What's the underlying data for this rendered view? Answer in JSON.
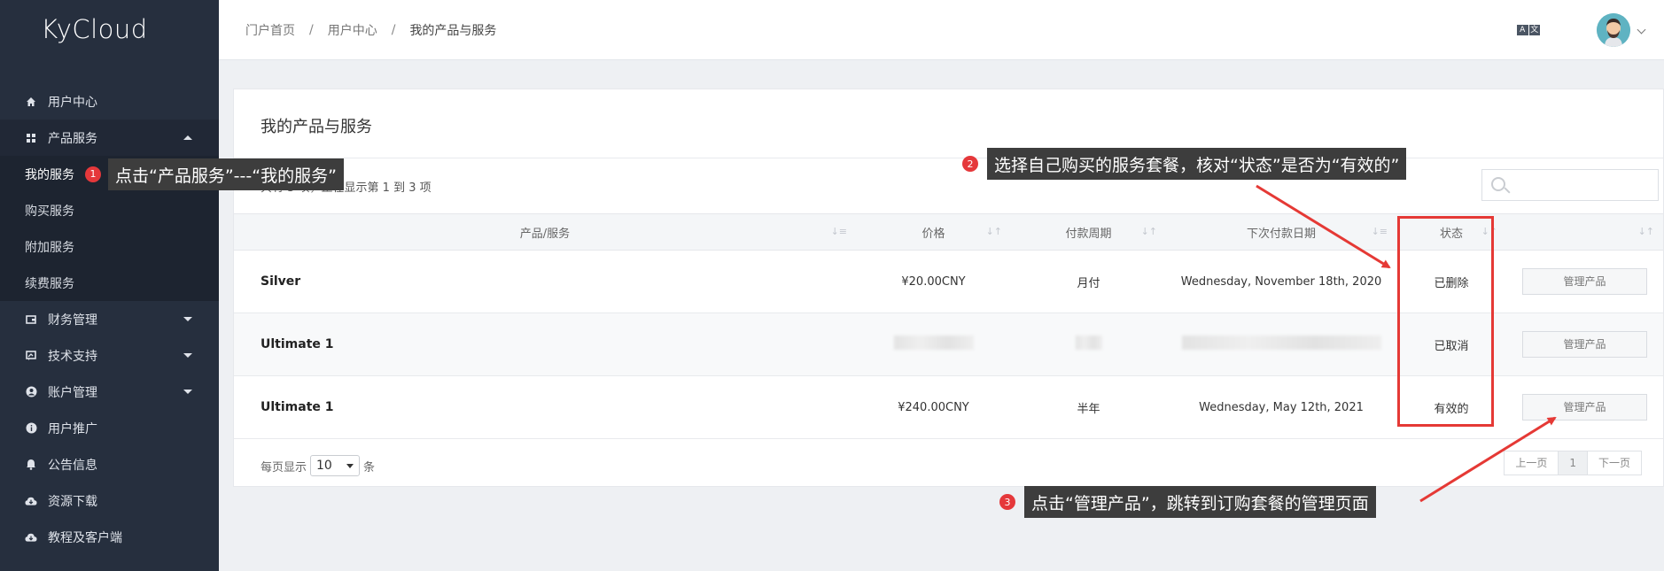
{
  "brand": "KyCloud",
  "sidebar": {
    "items": [
      {
        "label": "用户中心",
        "icon": "home-icon"
      },
      {
        "label": "产品服务",
        "icon": "grid-icon"
      },
      {
        "label": "财务管理",
        "icon": "wallet-icon"
      },
      {
        "label": "技术支持",
        "icon": "support-icon"
      },
      {
        "label": "账户管理",
        "icon": "user-icon"
      },
      {
        "label": "用户推广",
        "icon": "info-icon"
      },
      {
        "label": "公告信息",
        "icon": "bell-icon"
      },
      {
        "label": "资源下载",
        "icon": "cloud-download-icon"
      },
      {
        "label": "教程及客户端",
        "icon": "cloud-download-icon"
      }
    ],
    "sub_items": [
      "我的服务",
      "购买服务",
      "附加服务",
      "续费服务"
    ]
  },
  "breadcrumb": {
    "home": "门户首页",
    "user_center": "用户中心",
    "current": "我的产品与服务",
    "sep": "/"
  },
  "lang_icon": {
    "left": "A",
    "right": "文"
  },
  "panel": {
    "title": "我的产品与服务",
    "count": "共有 3 项，正在显示第 1 到 3 项"
  },
  "table": {
    "headers": [
      "产品/服务",
      "价格",
      "付款周期",
      "下次付款日期",
      "状态"
    ],
    "rows": [
      {
        "name": "Silver",
        "price": "¥20.00CNY",
        "cycle": "月付",
        "next": "Wednesday, November 18th, 2020",
        "status": "已删除",
        "action": "管理产品"
      },
      {
        "name": "Ultimate 1",
        "price": "",
        "cycle": "",
        "next": "",
        "status": "已取消",
        "action": "管理产品"
      },
      {
        "name": "Ultimate 1",
        "price": "¥240.00CNY",
        "cycle": "半年",
        "next": "Wednesday, May 12th, 2021",
        "status": "有效的",
        "action": "管理产品"
      }
    ]
  },
  "pagination": {
    "per_page_label": "每页显示",
    "per_page_value": "10",
    "unit": "条",
    "prev": "上一页",
    "page": "1",
    "next": "下一页"
  },
  "annotations": {
    "step1": {
      "num": "1",
      "text": "点击“产品服务”---“我的服务”"
    },
    "step2": {
      "num": "2",
      "text": "选择自己购买的服务套餐，核对“状态”是否为“有效的”"
    },
    "step3": {
      "num": "3",
      "text": "点击“管理产品”，跳转到订购套餐的管理页面"
    }
  },
  "colors": {
    "sidebar": "#262f3e",
    "annotation_red": "#e53935",
    "tooltip_bg": "#3d3d3d"
  }
}
